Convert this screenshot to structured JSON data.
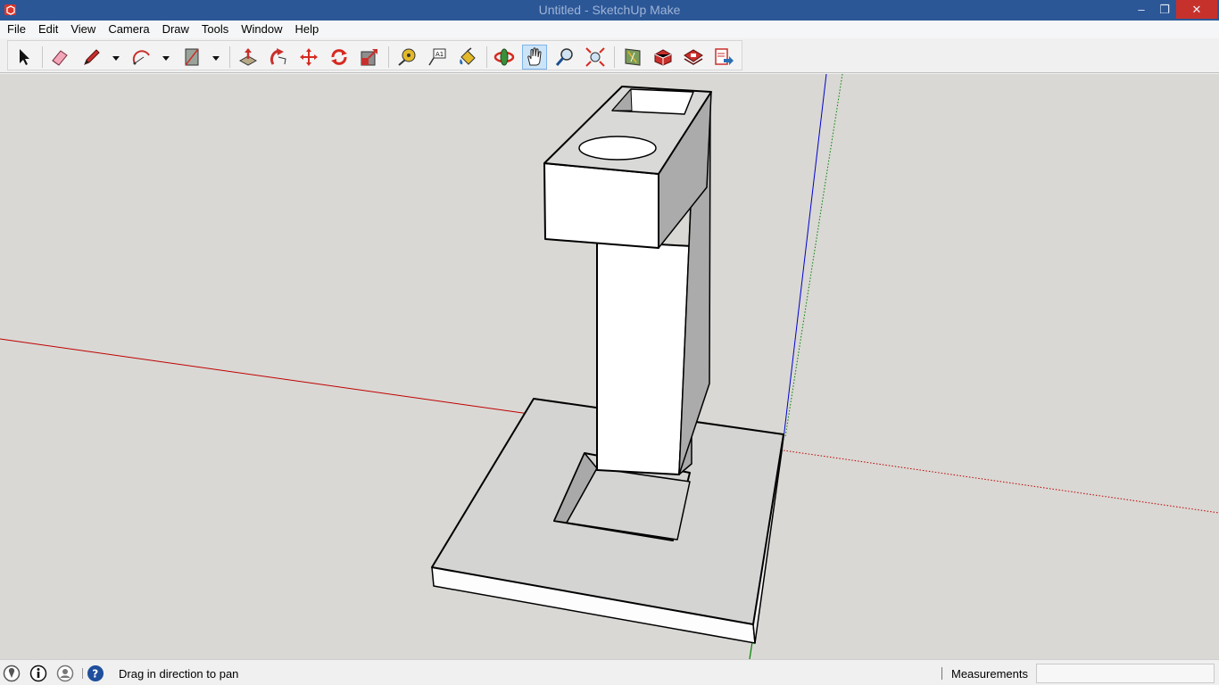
{
  "window": {
    "title": "Untitled - SketchUp Make",
    "controls": {
      "minimize": "‒",
      "maximize": "❐",
      "close": "✕"
    }
  },
  "menu": [
    "File",
    "Edit",
    "View",
    "Camera",
    "Draw",
    "Tools",
    "Window",
    "Help"
  ],
  "toolbar": {
    "tools": [
      {
        "name": "select",
        "icon": "arrow-cursor-icon"
      },
      {
        "name": "eraser",
        "icon": "eraser-icon"
      },
      {
        "name": "line",
        "icon": "pencil-icon"
      },
      {
        "name": "arc",
        "icon": "arc-icon"
      },
      {
        "name": "rectangle",
        "icon": "rectangle-icon"
      },
      {
        "name": "push-pull",
        "icon": "push-pull-icon"
      },
      {
        "name": "follow-me",
        "icon": "follow-me-icon"
      },
      {
        "name": "move",
        "icon": "move-icon"
      },
      {
        "name": "rotate",
        "icon": "rotate-icon"
      },
      {
        "name": "scale",
        "icon": "scale-icon"
      },
      {
        "name": "tape-measure",
        "icon": "tape-measure-icon"
      },
      {
        "name": "text",
        "icon": "text-icon"
      },
      {
        "name": "paint-bucket",
        "icon": "paint-bucket-icon"
      },
      {
        "name": "orbit",
        "icon": "orbit-icon"
      },
      {
        "name": "pan",
        "icon": "hand-icon",
        "active": true
      },
      {
        "name": "zoom",
        "icon": "magnifier-icon"
      },
      {
        "name": "zoom-extents",
        "icon": "zoom-extents-icon"
      },
      {
        "name": "add-location",
        "icon": "map-icon"
      },
      {
        "name": "3d-warehouse",
        "icon": "warehouse-icon"
      },
      {
        "name": "extension-warehouse",
        "icon": "extension-icon"
      },
      {
        "name": "share-model",
        "icon": "share-model-icon"
      }
    ]
  },
  "status": {
    "message": "Drag in direction to pan",
    "measurements_label": "Measurements",
    "measurements_value": "",
    "icons": [
      "geo-location-icon",
      "info-icon",
      "user-icon",
      "help-icon"
    ]
  },
  "colors": {
    "titlebar": "#2b5797",
    "close_button": "#c7312b",
    "viewport_background": "#d9d8d4",
    "red_axis": "#c00000",
    "green_axis": "#008000",
    "blue_axis": "#0000cc"
  }
}
